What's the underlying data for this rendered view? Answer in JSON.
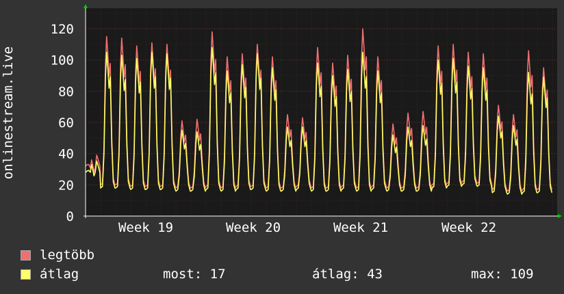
{
  "colors": {
    "background": "#333333",
    "plot": "#1a1a1a",
    "grid": "#5a2a2a",
    "max_series": "#f07070",
    "avg_series": "#ffff66",
    "arrow": "#00cc00"
  },
  "legend": {
    "max_label": "legtöbb",
    "avg_label": "átlag"
  },
  "stats": {
    "now": "most: 17",
    "avg": "átlag: 43",
    "max": "max: 109"
  },
  "chart_data": {
    "type": "line",
    "ylabel": "onlinestream.live",
    "ylim": [
      0,
      130
    ],
    "yticks": [
      0,
      20,
      40,
      60,
      80,
      100,
      120
    ],
    "xticks": [
      "Week 19",
      "Week 20",
      "Week 21",
      "Week 22"
    ],
    "grid": true,
    "legend_placement": "bottom",
    "series": [
      {
        "name": "legtöbb",
        "peaks": [
          36,
          115,
          114,
          109,
          111,
          110,
          61,
          62,
          118,
          102,
          104,
          110,
          102,
          65,
          63,
          108,
          98,
          103,
          120,
          102,
          59,
          66,
          67,
          109,
          110,
          105,
          104,
          71,
          65,
          106,
          95
        ],
        "troughs": [
          32,
          20,
          20,
          19,
          19,
          19,
          18,
          18,
          19,
          18,
          19,
          19,
          18,
          18,
          19,
          18,
          18,
          19,
          18,
          19,
          18,
          18,
          18,
          20,
          21,
          22,
          21,
          17,
          16,
          17,
          17
        ]
      },
      {
        "name": "átlag",
        "peaks": [
          33,
          105,
          103,
          101,
          105,
          104,
          55,
          54,
          108,
          93,
          97,
          104,
          95,
          57,
          57,
          98,
          90,
          94,
          105,
          93,
          52,
          57,
          58,
          100,
          101,
          96,
          95,
          64,
          58,
          92,
          89
        ],
        "troughs": [
          28,
          18,
          18,
          17,
          17,
          17,
          16,
          16,
          17,
          16,
          17,
          17,
          16,
          16,
          17,
          16,
          16,
          17,
          16,
          17,
          16,
          16,
          16,
          18,
          19,
          20,
          19,
          15,
          14,
          15,
          15
        ]
      }
    ]
  }
}
